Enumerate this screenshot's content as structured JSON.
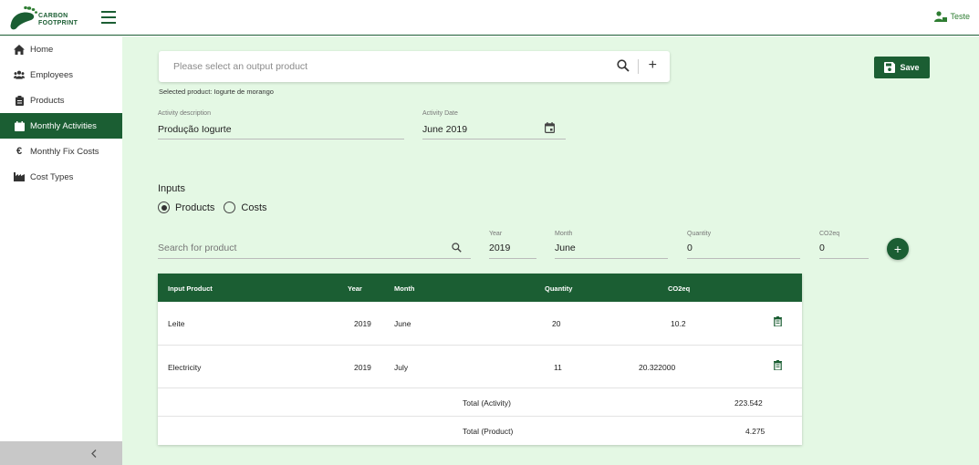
{
  "header": {
    "logo_line1": "CARBON",
    "logo_line2": "FOOTPRINT",
    "user_name": "Teste"
  },
  "sidebar": {
    "items": [
      {
        "label": "Home",
        "icon": "home-icon"
      },
      {
        "label": "Employees",
        "icon": "users-icon"
      },
      {
        "label": "Products",
        "icon": "clipboard-icon"
      },
      {
        "label": "Monthly Activities",
        "icon": "calendar-icon",
        "active": true
      },
      {
        "label": "Monthly Fix Costs",
        "icon": "euro-icon"
      },
      {
        "label": "Cost Types",
        "icon": "factory-icon"
      }
    ],
    "collapse_icon": "chevron-left-icon"
  },
  "product_search": {
    "placeholder": "Please select an output product",
    "selected_text": "Selected product: Iogurte de morango"
  },
  "save_label": "Save",
  "activity": {
    "description_label": "Activity description",
    "description_value": "Produção Iogurte",
    "date_label": "Activity Date",
    "date_value": "June 2019"
  },
  "inputs": {
    "title": "Inputs",
    "radio_products": "Products",
    "radio_costs": "Costs",
    "selected": "Products",
    "search_placeholder": "Search for product",
    "year_label": "Year",
    "year_value": "2019",
    "month_label": "Month",
    "month_value": "June",
    "quantity_label": "Quantity",
    "quantity_value": "0",
    "co2_label": "CO2eq",
    "co2_value": "0"
  },
  "table": {
    "headers": {
      "input_product": "Input Product",
      "year": "Year",
      "month": "Month",
      "quantity": "Quantity",
      "co2eq": "CO2eq"
    },
    "rows": [
      {
        "product": "Leite",
        "year": "2019",
        "month": "June",
        "quantity": "20",
        "co2eq": "10.2"
      },
      {
        "product": "Electricity",
        "year": "2019",
        "month": "July",
        "quantity": "11",
        "co2eq": "20.322000"
      }
    ],
    "total_activity_label": "Total (Activity)",
    "total_activity_value": "223.542",
    "total_product_label": "Total (Product)",
    "total_product_value": "4.275"
  },
  "colors": {
    "primary": "#1b5e33",
    "background": "#e4f8e4"
  }
}
